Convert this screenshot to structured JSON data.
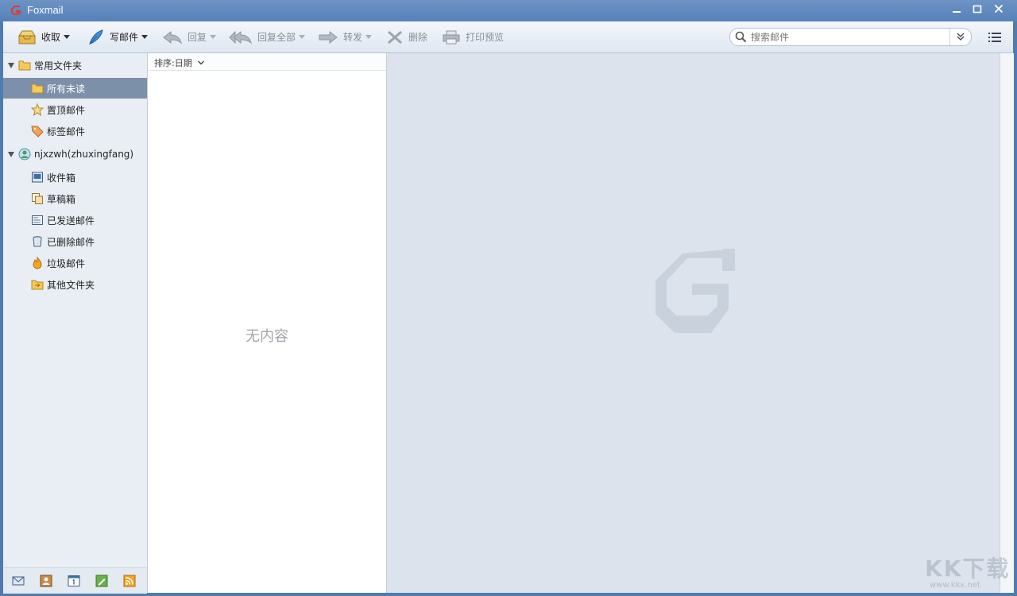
{
  "window": {
    "title": "Foxmail",
    "minimize": "—",
    "maximize": "☐",
    "close": "✕"
  },
  "toolbar": {
    "receive": "收取",
    "compose": "写邮件",
    "reply": "回复",
    "reply_all": "回复全部",
    "forward": "转发",
    "delete": "删除",
    "print_preview": "打印预览"
  },
  "search": {
    "placeholder": "搜索邮件",
    "value": ""
  },
  "sidebar": {
    "common_group": "常用文件夹",
    "common_items": [
      {
        "label": "所有未读",
        "icon": "folder-icon"
      },
      {
        "label": "置顶邮件",
        "icon": "star-icon"
      },
      {
        "label": "标签邮件",
        "icon": "tag-icon"
      }
    ],
    "account": "njxzwh(zhuxingfang)",
    "account_items": [
      {
        "label": "收件箱",
        "icon": "inbox-icon"
      },
      {
        "label": "草稿箱",
        "icon": "drafts-icon"
      },
      {
        "label": "已发送邮件",
        "icon": "sent-icon"
      },
      {
        "label": "已删除邮件",
        "icon": "trash-icon"
      },
      {
        "label": "垃圾邮件",
        "icon": "junk-icon"
      },
      {
        "label": "其他文件夹",
        "icon": "other-folder-icon"
      }
    ],
    "bottom_icons": [
      "mail-icon",
      "contacts-icon",
      "calendar-icon",
      "notes-icon",
      "rss-icon"
    ]
  },
  "list": {
    "sort_label": "排序:日期",
    "empty_text": "无内容"
  },
  "watermark": {
    "text": "KK下载",
    "url": "www.kkx.net"
  },
  "colors": {
    "titlebar": "#5b86bd",
    "selected": "#7d90a9",
    "reading_bg": "#dce3ec"
  }
}
